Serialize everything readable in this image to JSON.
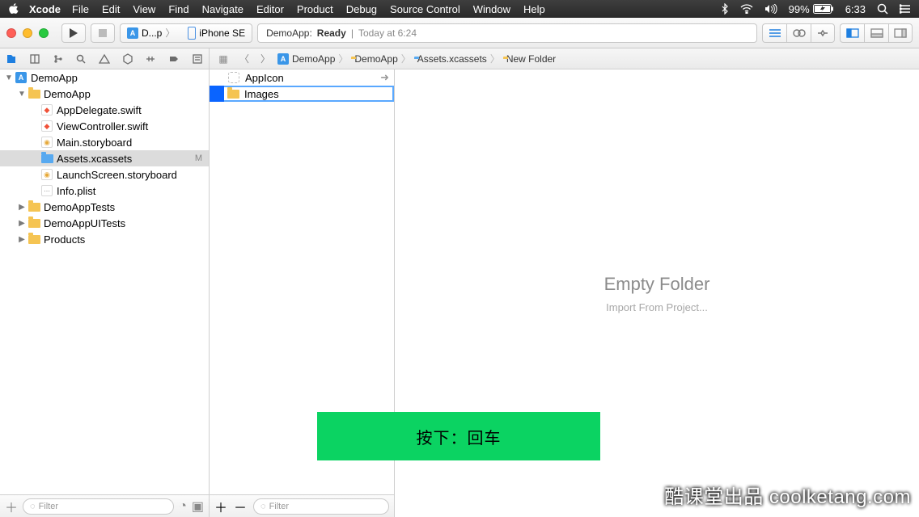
{
  "menubar": {
    "app": "Xcode",
    "items": [
      "File",
      "Edit",
      "View",
      "Find",
      "Navigate",
      "Editor",
      "Product",
      "Debug",
      "Source Control",
      "Window",
      "Help"
    ],
    "battery": "99%",
    "clock": "6:33"
  },
  "toolbar": {
    "scheme_target": "D...p",
    "scheme_device": "iPhone SE",
    "status_app": "DemoApp:",
    "status_state": "Ready",
    "status_time": "Today at 6:24"
  },
  "breadcrumb": [
    "DemoApp",
    "DemoApp",
    "Assets.xcassets",
    "New Folder"
  ],
  "tree": [
    {
      "d": 0,
      "open": true,
      "icon": "proj",
      "label": "DemoApp"
    },
    {
      "d": 1,
      "open": true,
      "icon": "folder",
      "label": "DemoApp"
    },
    {
      "d": 2,
      "icon": "swift",
      "label": "AppDelegate.swift"
    },
    {
      "d": 2,
      "icon": "swift",
      "label": "ViewController.swift"
    },
    {
      "d": 2,
      "icon": "story",
      "label": "Main.storyboard"
    },
    {
      "d": 2,
      "icon": "assets",
      "label": "Assets.xcassets",
      "sel": true,
      "badge": "M"
    },
    {
      "d": 2,
      "icon": "story",
      "label": "LaunchScreen.storyboard"
    },
    {
      "d": 2,
      "icon": "plist",
      "label": "Info.plist"
    },
    {
      "d": 1,
      "closed": true,
      "icon": "folder",
      "label": "DemoAppTests"
    },
    {
      "d": 1,
      "closed": true,
      "icon": "folder",
      "label": "DemoAppUITests"
    },
    {
      "d": 1,
      "closed": true,
      "icon": "folder",
      "label": "Products"
    }
  ],
  "assets": {
    "appicon": "AppIcon",
    "editing_value": "Images"
  },
  "detail": {
    "title": "Empty Folder",
    "sub": "Import From Project..."
  },
  "filter_placeholder": "Filter",
  "toast": "按下：回车",
  "watermark": "酷课堂出品 coolketang.com"
}
